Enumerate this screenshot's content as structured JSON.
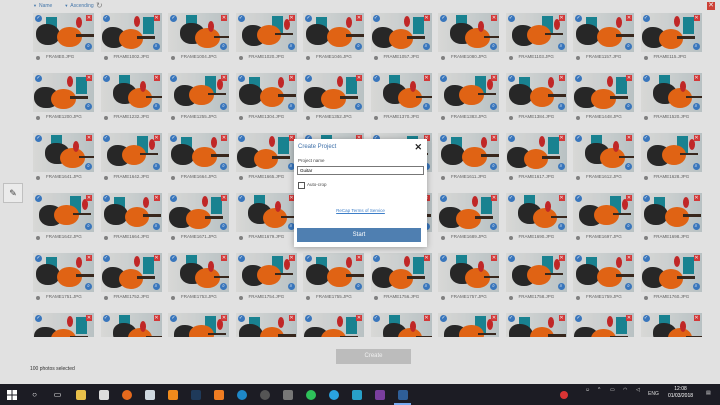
{
  "toolbar": {
    "sort_field": "Name",
    "sort_order": "Ascending"
  },
  "photos": [
    "FRAME0.JPG",
    "FRAME1002.JPG",
    "FRAME1004.JPG",
    "FRAME1020.JPG",
    "FRAME1046.JPG",
    "FRAME1057.JPG",
    "FRAME1080.JPG",
    "FRAME1103.JPG",
    "FRAME1157.JPG",
    "FRAME115.JPG",
    "FRAME1200.JPG",
    "FRAME1232.JPG",
    "FRAME1255.JPG",
    "FRAME1304.JPG",
    "FRAME1352.JPG",
    "FRAME1370.JPG",
    "FRAME1383.JPG",
    "FRAME1384.JPG",
    "FRAME1448.JPG",
    "FRAME1520.JPG",
    "FRAME1641.JPG",
    "FRAME1642.JPG",
    "FRAME1664.JPG",
    "FRAME1665.JPG",
    "FRAME1667.JPG",
    "FRAME1672.JPG",
    "FRAME1611.JPG",
    "FRAME1617.JPG",
    "FRAME1612.JPG",
    "FRAME1628.JPG",
    "FRAME1642.JPG",
    "FRAME1664.JPG",
    "FRAME1671.JPG",
    "FRAME1679.JPG",
    "FRAME1680.JPG",
    "FRAME1681.JPG",
    "FRAME1689.JPG",
    "FRAME1690.JPG",
    "FRAME1697.JPG",
    "FRAME1698.JPG",
    "FRAME1751.JPG",
    "FRAME1752.JPG",
    "FRAME1753.JPG",
    "FRAME1754.JPG",
    "FRAME1755.JPG",
    "FRAME1756.JPG",
    "FRAME1757.JPG",
    "FRAME1758.JPG",
    "FRAME1759.JPG",
    "FRAME1760.JPG",
    "",
    "",
    "",
    "",
    "",
    "",
    "",
    "",
    "",
    ""
  ],
  "modal": {
    "title": "Create Project",
    "project_name_label": "Project name",
    "project_name_value": "Guitar",
    "autocrop_label": "Auto-crop",
    "tos_link": "ReCap Terms of Service",
    "start_label": "Start"
  },
  "footer": {
    "create_label": "Create",
    "selected_count": "100 photos selected"
  },
  "taskbar": {
    "language": "ENG",
    "time": "12:08",
    "date": "01/03/2018"
  },
  "icons": {
    "sort": "caret-down-icon",
    "refresh": "refresh-icon",
    "select": "check-icon",
    "delete": "close-icon",
    "inspect": "magnifier-icon",
    "side_tool": "annotate-icon"
  },
  "colors": {
    "accent": "#4f7fb1",
    "delete": "#e03c3c",
    "taskbar": "#1c1c24"
  }
}
